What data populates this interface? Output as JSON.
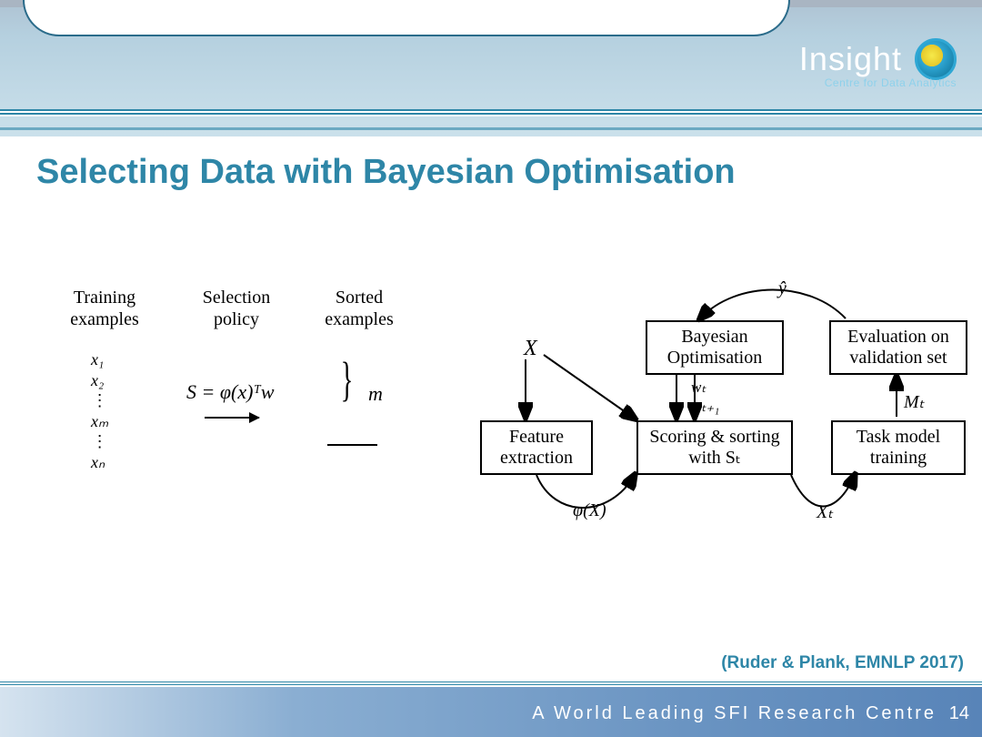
{
  "brand": {
    "name": "Insight",
    "tagline": "Centre for Data Analytics"
  },
  "title": "Selecting Data with Bayesian Optimisation",
  "columns": {
    "training_label": "Training examples",
    "selection_label": "Selection policy",
    "sorted_label": "Sorted examples",
    "x_list": [
      "x₁",
      "x₂",
      "⋮",
      "xₘ",
      "⋮",
      "xₙ"
    ],
    "formula": "S = φ(x)ᵀw",
    "m_label": "m"
  },
  "diagram": {
    "input": "X",
    "feature_box": "Feature extraction",
    "bayes_box": "Bayesian Optimisation",
    "scoring_box": "Scoring & sorting with Sₜ",
    "eval_box": "Evaluation on validation set",
    "task_box": "Task model training",
    "phi_label": "φ(X)",
    "wt_label": "wₜ",
    "wt1_label": "wₜ₊₁",
    "xt_label": "Xₜ",
    "mt_label": "Mₜ",
    "yhat_label": "ŷ"
  },
  "citation": "(Ruder & Plank, EMNLP 2017)",
  "footer": {
    "text": "A World Leading SFI Research Centre",
    "page": "14"
  }
}
